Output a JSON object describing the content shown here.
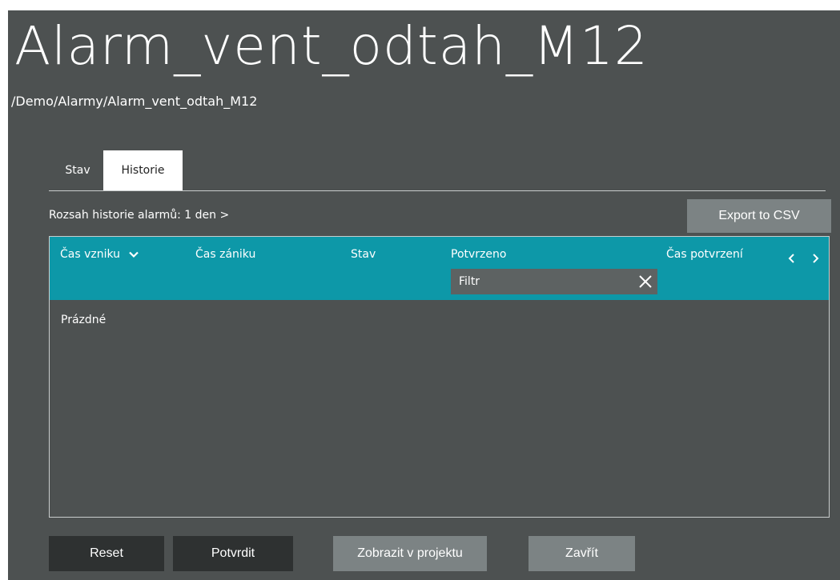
{
  "window": {
    "title": "Alarm_vent_odtah_M12",
    "path": "/Demo/Alarmy/Alarm_vent_odtah_M12"
  },
  "tabs": [
    {
      "label": "Stav",
      "active": false
    },
    {
      "label": "Historie",
      "active": true
    }
  ],
  "history": {
    "range_label": "Rozsah historie alarmů: 1 den",
    "range_chevron": ">",
    "export_label": "Export to CSV"
  },
  "table": {
    "columns": [
      "Čas vzniku",
      "Čas zániku",
      "Stav",
      "Potvrzeno",
      "Čas potvrzení"
    ],
    "sort_icon": "chevron-down-icon",
    "filter_placeholder": "Filtr",
    "empty_text": "Prázdné",
    "header_color": "#0d98a8"
  },
  "buttons": {
    "reset": "Reset",
    "confirm": "Potvrdit",
    "show_in_project": "Zobrazit v projektu",
    "close": "Zavřít"
  },
  "colors": {
    "background": "#4d5151",
    "button_dark": "#2e3131",
    "button_grey": "#7c8384"
  }
}
